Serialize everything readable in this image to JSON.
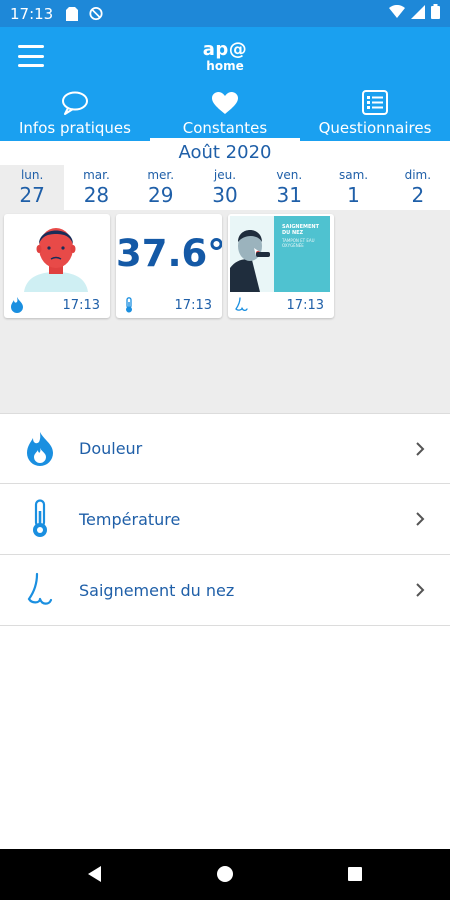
{
  "status_bar": {
    "time": "17:13"
  },
  "app_bar": {
    "logo_line1": "ap@",
    "logo_line2": "home"
  },
  "tabs": [
    {
      "label": "Infos pratiques",
      "icon": "chat-bubble-icon",
      "active": false
    },
    {
      "label": "Constantes",
      "icon": "heart-icon",
      "active": true
    },
    {
      "label": "Questionnaires",
      "icon": "checklist-icon",
      "active": false
    }
  ],
  "calendar": {
    "month": "Août 2020",
    "days": [
      {
        "name": "lun.",
        "num": "27",
        "selected": true
      },
      {
        "name": "mar.",
        "num": "28",
        "selected": false
      },
      {
        "name": "mer.",
        "num": "29",
        "selected": false
      },
      {
        "name": "jeu.",
        "num": "30",
        "selected": false
      },
      {
        "name": "ven.",
        "num": "31",
        "selected": false
      },
      {
        "name": "sam.",
        "num": "1",
        "selected": false
      },
      {
        "name": "dim.",
        "num": "2",
        "selected": false
      }
    ]
  },
  "cards": [
    {
      "type": "douleur",
      "icon": "flame-icon",
      "time": "17:13"
    },
    {
      "type": "temperature",
      "value": "37.6°",
      "icon": "thermometer-icon",
      "time": "17:13"
    },
    {
      "type": "saignement",
      "icon": "nose-icon",
      "time": "17:13",
      "thumb_title": "SAIGNEMENT DU NEZ",
      "thumb_sub": "TAMPON ET EAU OXYGÉNÉE"
    }
  ],
  "list": [
    {
      "label": "Douleur",
      "icon": "flame-icon"
    },
    {
      "label": "Température",
      "icon": "thermometer-icon"
    },
    {
      "label": "Saignement du nez",
      "icon": "nose-icon"
    }
  ],
  "colors": {
    "primary": "#1aa0f0",
    "status": "#1e88d8",
    "text_blue": "#1f5fa8",
    "dark_blue": "#1459a6",
    "gray_bg": "#ededed"
  }
}
